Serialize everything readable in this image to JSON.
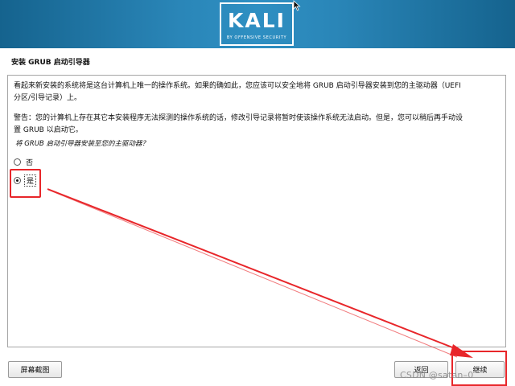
{
  "header": {
    "logo_text": "KALI",
    "logo_tagline": "BY OFFENSIVE SECURITY"
  },
  "page_title": "安装 GRUB 启动引导器",
  "body": {
    "paragraph1_line1": "看起来新安装的系统将是这台计算机上唯一的操作系统。如果的确如此，您应该可以安全地将 GRUB 启动引导器安装到您的主驱动器（UEFI",
    "paragraph1_line2": "分区/引导记录）上。",
    "paragraph2_line1": "警告：您的计算机上存在其它本安装程序无法探测的操作系统的话，修改引导记录将暂时使该操作系统无法启动。但是，您可以稍后再手动设",
    "paragraph2_line2": "置 GRUB 以启动它。",
    "question": "将 GRUB 启动引导器安装至您的主驱动器？"
  },
  "options": [
    {
      "label": "否",
      "selected": false
    },
    {
      "label": "是",
      "selected": true
    }
  ],
  "buttons": {
    "screenshot": "屏幕截图",
    "back": "返回",
    "continue": "继续"
  },
  "annotation_color": "#e8262a",
  "accent_color": "#2a86b8",
  "watermark": "CSDN @satan–0"
}
